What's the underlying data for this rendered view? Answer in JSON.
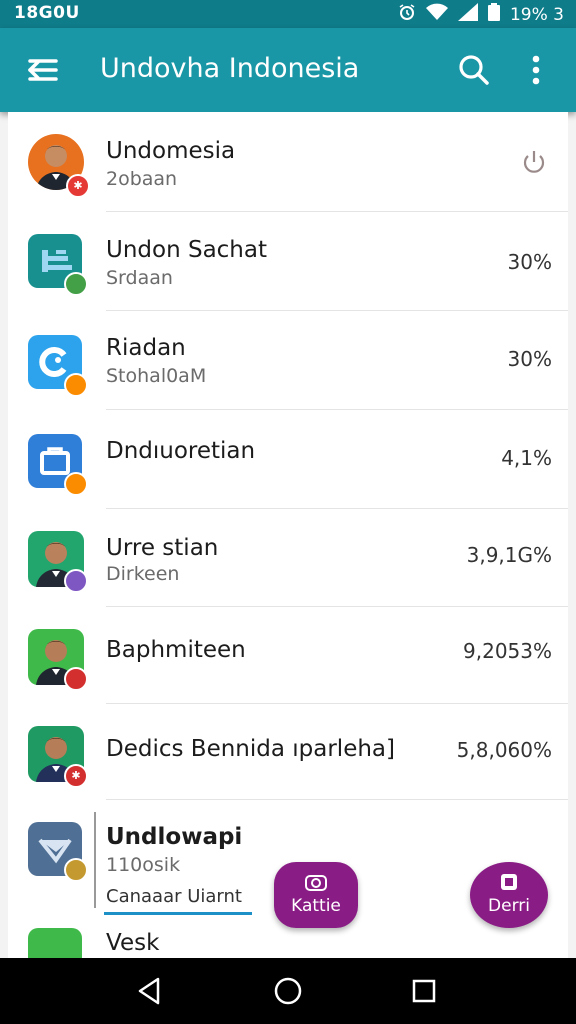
{
  "status_bar": {
    "time": "18G0U",
    "battery": "19% 3"
  },
  "app_bar": {
    "title": "Undovha Indonesia",
    "icons": [
      "menu-icon",
      "search-icon",
      "more-vert-icon"
    ]
  },
  "list": [
    {
      "title": "Undomesia",
      "subtitle": "2obaan",
      "value": "",
      "trailing_icon": "power-icon",
      "badge_color": "#e53935",
      "badge_glyph": "✱"
    },
    {
      "title": "Undon Sachat",
      "subtitle": "Srdaan",
      "value": "30%",
      "badge_color": "#43a047",
      "badge_glyph": ""
    },
    {
      "title": "Riadan",
      "subtitle": "Stohal0aM",
      "value": "30%",
      "badge_color": "#fb8c00",
      "badge_glyph": ""
    },
    {
      "title": "Dndıuoretian",
      "subtitle": "",
      "value": "4,1%",
      "badge_color": "#fb8c00",
      "badge_glyph": ""
    },
    {
      "title": "Urre stian",
      "subtitle": "Dirkeen",
      "value": "3,9,1G%",
      "badge_color": "#7e57c2",
      "badge_glyph": ""
    },
    {
      "title": "Baphmiteen",
      "subtitle": "",
      "value": "9,2053%",
      "badge_color": "#d32f2f",
      "badge_glyph": ""
    },
    {
      "title": "Dedics Bennida ıparleha]",
      "subtitle": "",
      "value": "5,8,060%",
      "badge_color": "#d32f2f",
      "badge_glyph": "✱"
    },
    {
      "title": "Undlowapi",
      "subtitle": "110osik",
      "value": "",
      "badge_color": "#c49a30",
      "badge_glyph": ""
    },
    {
      "title": "Vesk",
      "subtitle": "",
      "value": ""
    }
  ],
  "input": {
    "value": "Canaaar Uiarnt"
  },
  "fabs": [
    {
      "label": "Kattie",
      "icon": "camera-icon"
    },
    {
      "label": "Derri",
      "icon": "square-icon"
    }
  ],
  "nav": {
    "icons": [
      "back-icon",
      "home-icon",
      "recents-icon"
    ]
  },
  "colors": {
    "status": "#0f7c8a",
    "appbar": "#1a97a6",
    "fab": "#8a1c86",
    "input_underline": "#1e90c8"
  }
}
